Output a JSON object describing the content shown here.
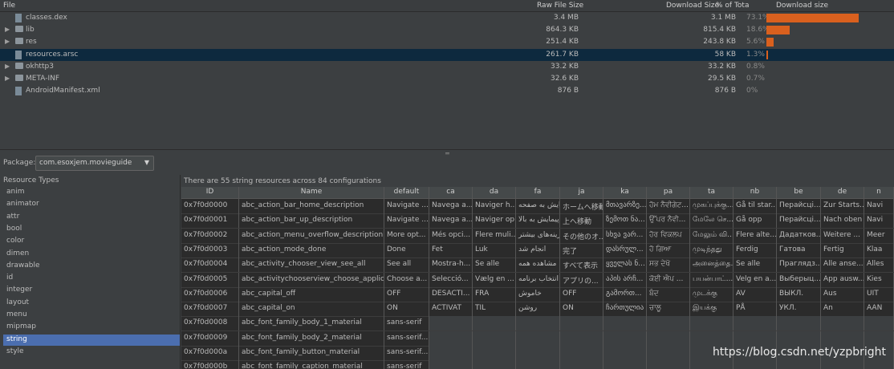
{
  "top_header": {
    "file": "File",
    "raw_size": "Raw File Size",
    "download_size": "Download Size",
    "pct_total": "% of Tota",
    "download_size_bar": "Download size"
  },
  "files": [
    {
      "name": "classes.dex",
      "raw": "3.4 MB",
      "dl": "3.1 MB",
      "pct": "73.1%",
      "bar": 0.731,
      "kind": "file",
      "expandable": false
    },
    {
      "name": "lib",
      "raw": "864.3 KB",
      "dl": "815.4 KB",
      "pct": "18.6%",
      "bar": 0.186,
      "kind": "folder",
      "expandable": true
    },
    {
      "name": "res",
      "raw": "251.4 KB",
      "dl": "243.8 KB",
      "pct": "5.6%",
      "bar": 0.056,
      "kind": "folder",
      "expandable": true
    },
    {
      "name": "resources.arsc",
      "raw": "261.7 KB",
      "dl": "58 KB",
      "pct": "1.3%",
      "bar": 0.013,
      "kind": "file",
      "expandable": false,
      "selected": true
    },
    {
      "name": "okhttp3",
      "raw": "33.2 KB",
      "dl": "33.2 KB",
      "pct": "0.8%",
      "bar": 0,
      "kind": "folder",
      "expandable": true
    },
    {
      "name": "META-INF",
      "raw": "32.6 KB",
      "dl": "29.5 KB",
      "pct": "0.7%",
      "bar": 0,
      "kind": "folder",
      "expandable": true
    },
    {
      "name": "AndroidManifest.xml",
      "raw": "876 B",
      "dl": "876 B",
      "pct": "0%",
      "bar": 0,
      "kind": "file",
      "expandable": false
    }
  ],
  "package": {
    "label": "Package:",
    "value": "com.esoxjem.movieguide"
  },
  "resource_types": {
    "header": "Resource Types",
    "items": [
      "anim",
      "animator",
      "attr",
      "bool",
      "color",
      "dimen",
      "drawable",
      "id",
      "integer",
      "layout",
      "menu",
      "mipmap",
      "string",
      "style"
    ],
    "selected": "string"
  },
  "summary": "There are 55 string resources across 84 configurations",
  "table": {
    "columns": [
      "ID",
      "Name",
      "default",
      "ca",
      "da",
      "fa",
      "ja",
      "ka",
      "pa",
      "ta",
      "nb",
      "be",
      "de",
      "n"
    ],
    "rows": [
      [
        "0x7f0d0000",
        "abc_action_bar_home_description",
        "Navigate ...",
        "Navega a...",
        "Naviger h...",
        "پیمایش به صفحه...",
        "ホームへ移動",
        "მთავარზე...",
        "ਹੋਮ ਨੈਵੀਗੇਟ...",
        "முகப்புக்கு...",
        "Gå til star...",
        "Перайсці...",
        "Zur Starts...",
        "Navi"
      ],
      [
        "0x7f0d0001",
        "abc_action_bar_up_description",
        "Navigate ...",
        "Navega a...",
        "Naviger op",
        "پیمایش به بالا",
        "上へ移動",
        "ზემოთ ნა...",
        "ਉੱਪਰ ਨੈਵੀ...",
        "மேலே செ...",
        "Gå opp",
        "Перайсці...",
        "Nach oben",
        "Navi"
      ],
      [
        "0x7f0d0002",
        "abc_action_menu_overflow_description",
        "More opt...",
        "Més opci...",
        "Flere muli...",
        "گزینه‌های بیشتر",
        "その他のオ...",
        "სხვა ვარ...",
        "ਹੋਰ ਵਿਕਲਪ",
        "மேலும் வி...",
        "Flere alte...",
        "Дадатков...",
        "Weitere ...",
        "Meer"
      ],
      [
        "0x7f0d0003",
        "abc_action_mode_done",
        "Done",
        "Fet",
        "Luk",
        "انجام شد",
        "完了",
        "დასრულ...",
        "ਹੋ ਗਿਆ",
        "முடிந்தது",
        "Ferdig",
        "Гатова",
        "Fertig",
        "Klaa"
      ],
      [
        "0x7f0d0004",
        "abc_activity_chooser_view_see_all",
        "See all",
        "Mostra-h...",
        "Se alle",
        "مشاهده همه",
        "すべて表示",
        "ყველას ნ...",
        "ਸਭ ਦੇਖੋ",
        "அனைத்தை...",
        "Se alle",
        "Праглядз...",
        "Alle anse...",
        "Alles"
      ],
      [
        "0x7f0d0005",
        "abc_activitychooserview_choose_applica...",
        "Choose a...",
        "Selecció...",
        "Vælg en ...",
        "انتخاب برنامه",
        "アプリの...",
        "აპის არჩ...",
        "ਕੋਈ ਐਪ ...",
        "பயன்பாட்...",
        "Velg en a...",
        "Выберыц...",
        "App ausw...",
        "Kies"
      ],
      [
        "0x7f0d0006",
        "abc_capital_off",
        "OFF",
        "DESACTI...",
        "FRA",
        "خاموش",
        "OFF",
        "გამორთ...",
        "ਬੰਦ",
        "முடக்கு",
        "AV",
        "ВЫКЛ.",
        "Aus",
        "UIT"
      ],
      [
        "0x7f0d0007",
        "abc_capital_on",
        "ON",
        "ACTIVAT",
        "TIL",
        "روشن",
        "ON",
        "ჩართულია",
        "ਚਾਲੂ",
        "இயக்கு",
        "PÅ",
        "УКЛ.",
        "An",
        "AAN"
      ],
      [
        "0x7f0d0008",
        "abc_font_family_body_1_material",
        "sans-serif"
      ],
      [
        "0x7f0d0009",
        "abc_font_family_body_2_material",
        "sans-serif..."
      ],
      [
        "0x7f0d000a",
        "abc_font_family_button_material",
        "sans-serif..."
      ],
      [
        "0x7f0d000b",
        "abc_font_family_caption_material",
        "sans-serif"
      ]
    ]
  },
  "watermark": "https://blog.csdn.net/yzpbright"
}
